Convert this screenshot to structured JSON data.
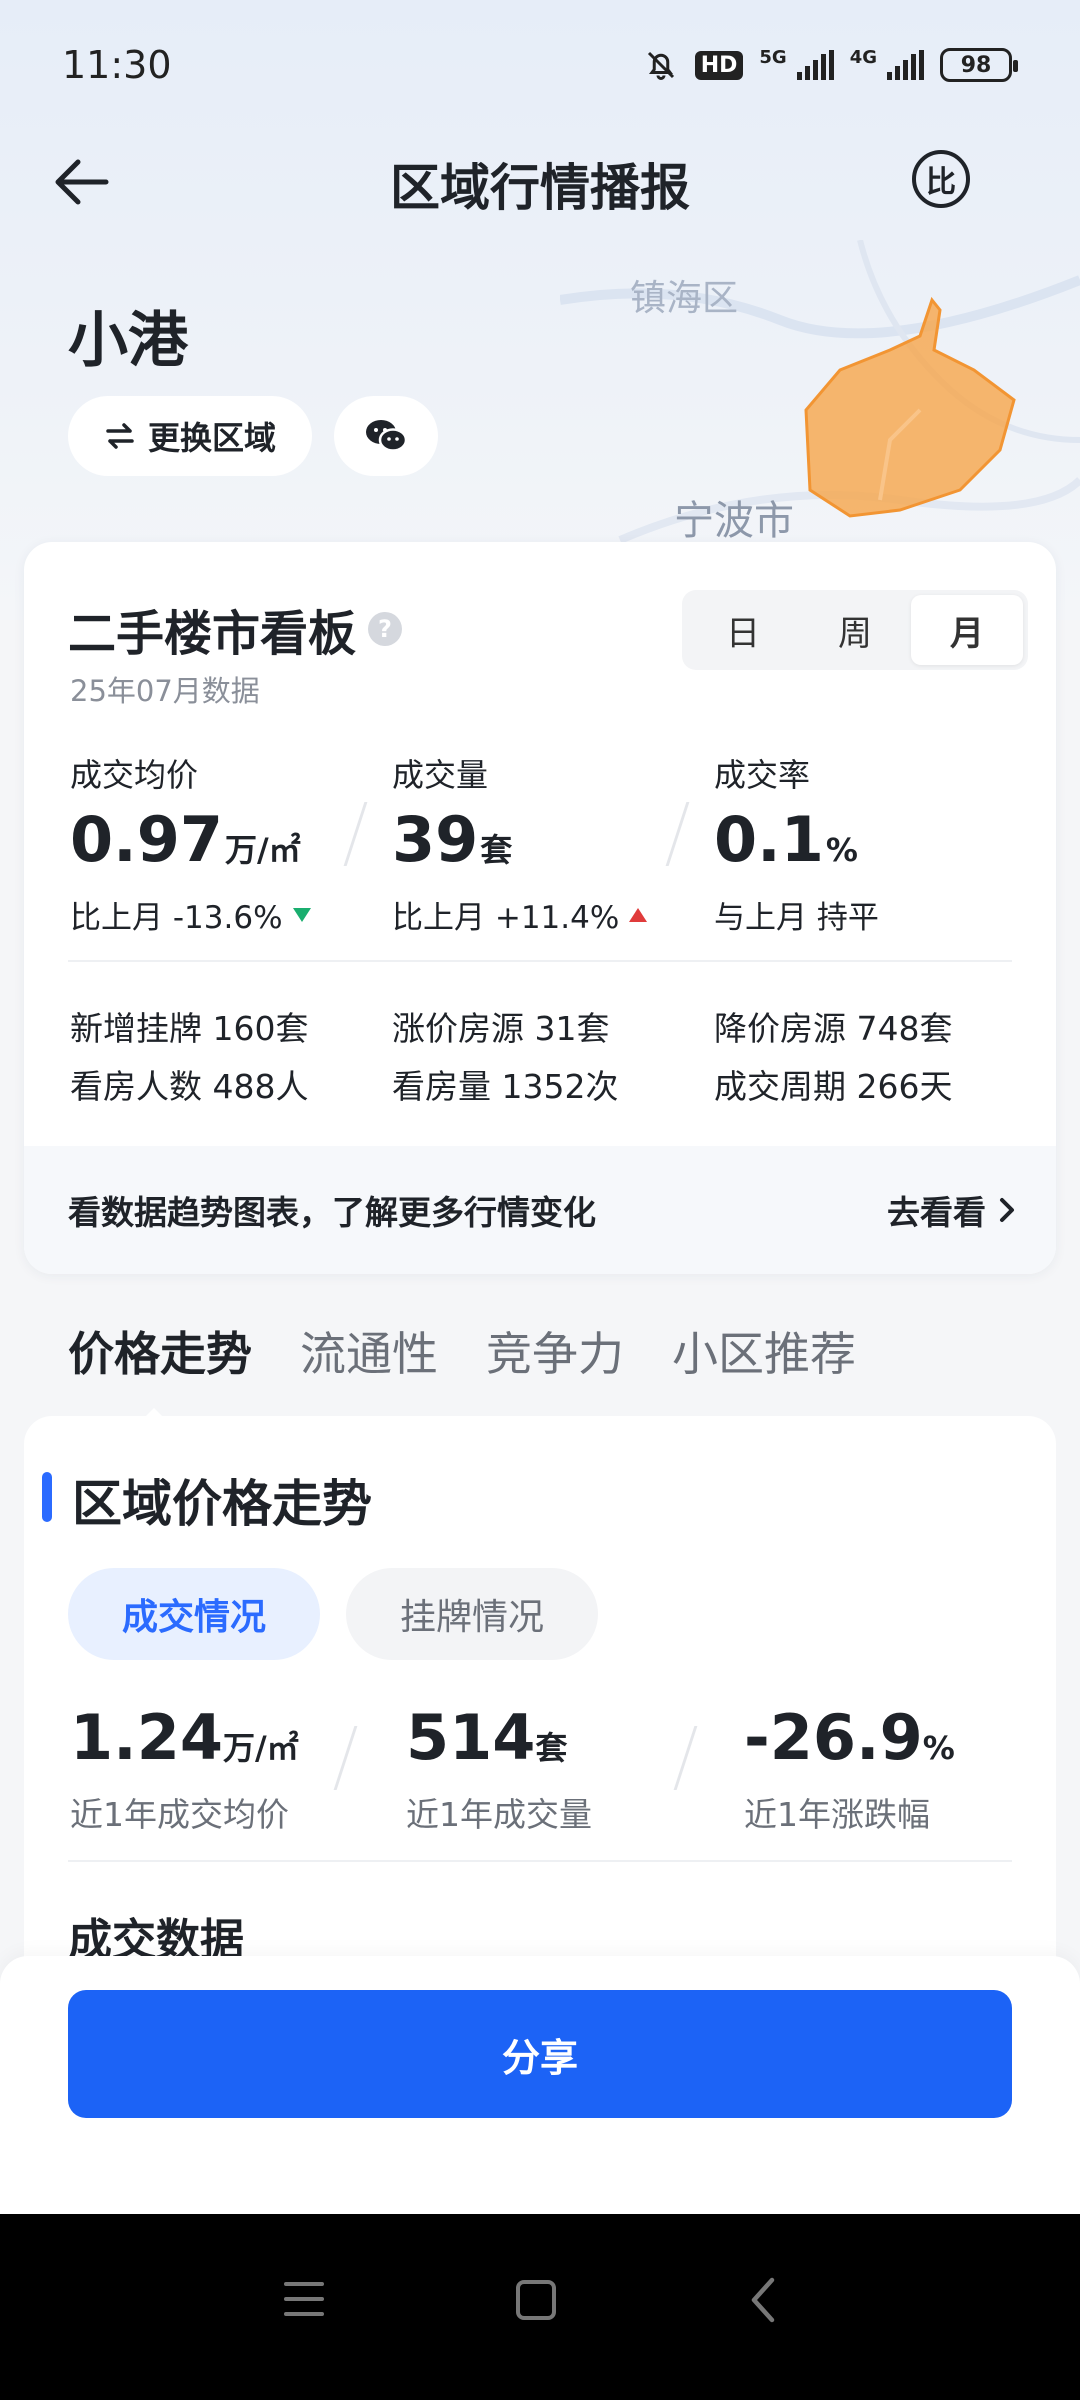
{
  "status_bar": {
    "time": "11:30",
    "hd_label": "HD",
    "net1": "5G",
    "net2": "4G",
    "battery": "98"
  },
  "nav": {
    "title": "区域行情播报",
    "compare_icon_text": "比"
  },
  "map": {
    "label_district": "镇海区",
    "label_city": "宁波市",
    "highlight_color": "#f6a54a"
  },
  "area": {
    "name": "小港",
    "change_label": "更换区域"
  },
  "board": {
    "title": "二手楼市看板",
    "help_icon_text": "?",
    "subtitle": "25年07月数据",
    "periods": [
      "日",
      "周",
      "月"
    ],
    "active_period": "月",
    "metrics": [
      {
        "label": "成交均价",
        "value": "0.97",
        "unit": "万/㎡",
        "change_prefix": "比上月",
        "change": "-13.6%",
        "trend": "down"
      },
      {
        "label": "成交量",
        "value": "39",
        "unit": "套",
        "change_prefix": "比上月",
        "change": "+11.4%",
        "trend": "up"
      },
      {
        "label": "成交率",
        "value": "0.1",
        "unit": "%",
        "change_prefix": "与上月",
        "change": "持平",
        "trend": "flat"
      }
    ],
    "stats": [
      {
        "label": "新增挂牌",
        "value": "160套"
      },
      {
        "label": "涨价房源",
        "value": "31套"
      },
      {
        "label": "降价房源",
        "value": "748套"
      },
      {
        "label": "看房人数",
        "value": "488人"
      },
      {
        "label": "看房量",
        "value": "1352次"
      },
      {
        "label": "成交周期",
        "value": "266天"
      }
    ],
    "footer_text": "看数据趋势图表，了解更多行情变化",
    "footer_link": "去看看"
  },
  "tabs": [
    "价格走势",
    "流通性",
    "竞争力",
    "小区推荐"
  ],
  "price_section": {
    "title": "区域价格走势",
    "chips": [
      "成交情况",
      "挂牌情况"
    ],
    "kpis": [
      {
        "value": "1.24",
        "unit": "万/㎡",
        "label": "近1年成交均价"
      },
      {
        "value": "514",
        "unit": "套",
        "label": "近1年成交量"
      },
      {
        "value": "-26.9",
        "unit": "%",
        "label": "近1年涨跌幅"
      }
    ],
    "sub_title": "成交数据"
  },
  "share": {
    "label": "分享",
    "color": "#1c63f6"
  },
  "colors": {
    "accent": "#2b6bff",
    "down": "#1aae6f",
    "up": "#e03b3b"
  }
}
